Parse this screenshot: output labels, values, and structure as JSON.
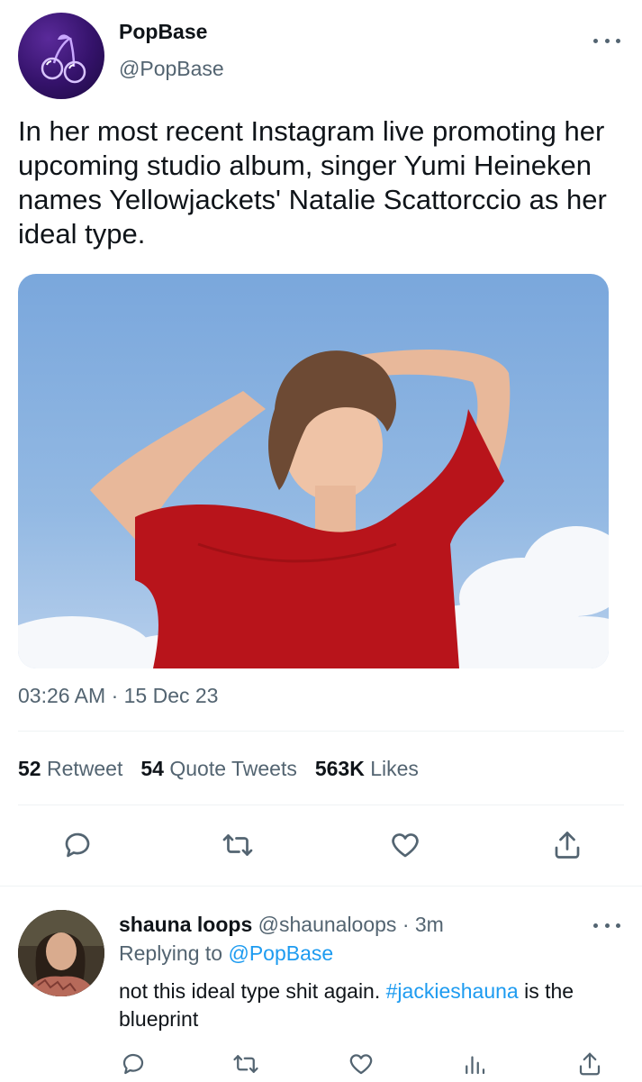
{
  "tweet": {
    "author_name": "PopBase",
    "author_handle": "@PopBase",
    "text": "In her most recent Instagram live promoting her upcoming studio album, singer Yumi Heineken names Yellowjackets' Natalie Scattorccio as her ideal type.",
    "timestamp": "03:26 AM · 15 Dec 23",
    "stats": {
      "retweets_count": "52",
      "retweets_label": "Retweet",
      "quotes_count": "54",
      "quotes_label": "Quote Tweets",
      "likes_count": "563K",
      "likes_label": "Likes"
    }
  },
  "reply": {
    "author_name": "shauna loops",
    "author_handle": "@shaunaloops",
    "time": "· 3m",
    "replying_prefix": "Replying to",
    "replying_to": "@PopBase",
    "text_part1": "not this ideal type shit again.",
    "hashtag": "#jackieshauna",
    "text_part2": "is the blueprint"
  },
  "icons": [
    "more-icon",
    "reply-icon",
    "retweet-icon",
    "like-icon",
    "share-icon",
    "views-icon"
  ],
  "colors": {
    "text": "#0f1419",
    "muted": "#536471",
    "link": "#1d9bf0",
    "divider": "#eff3f4",
    "avatar_bg": "#34126a"
  }
}
